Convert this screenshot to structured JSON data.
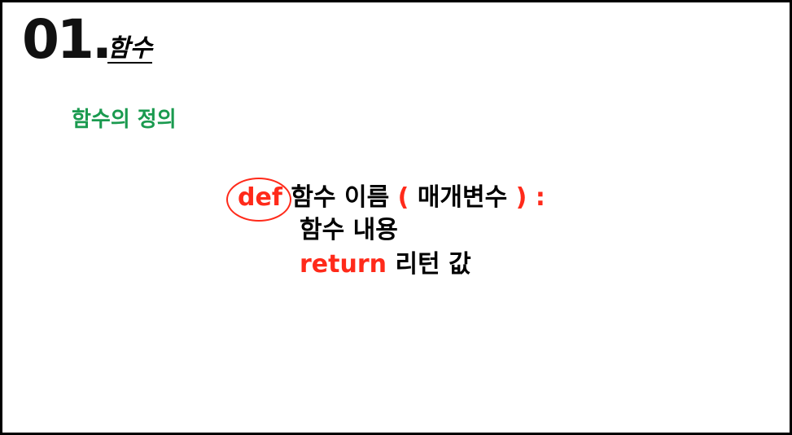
{
  "header": {
    "number": "01.",
    "title": "함수"
  },
  "subtitle": "함수의 정의",
  "code": {
    "line1": {
      "keyword": "def",
      "name": "함수 이름",
      "open_paren": "(",
      "params": "매개변수",
      "close_paren": ")",
      "colon": ":"
    },
    "line2": {
      "body": "함수 내용"
    },
    "line3": {
      "keyword": "return",
      "value": "리턴 값"
    }
  },
  "colors": {
    "keyword": "#ff2a1a",
    "subtitle": "#1a9a4f",
    "text": "#000000",
    "border": "#000000"
  }
}
